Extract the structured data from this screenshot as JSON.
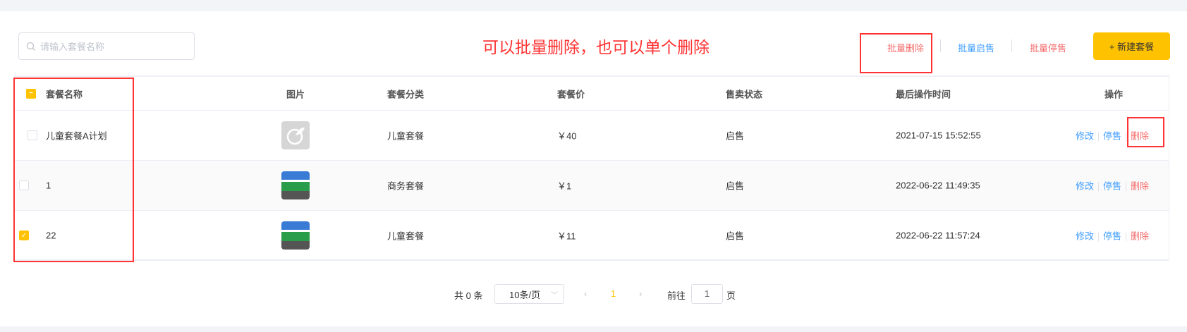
{
  "search": {
    "placeholder": "请输入套餐名称"
  },
  "annotation": "可以批量删除，也可以单个删除",
  "toolbar": {
    "batch_delete": "批量删除",
    "batch_enable": "批量启售",
    "batch_disable": "批量停售",
    "new_button": "+ 新建套餐"
  },
  "table": {
    "headers": [
      "套餐名称",
      "图片",
      "套餐分类",
      "套餐价",
      "售卖状态",
      "最后操作时间",
      "操作"
    ],
    "rows": [
      {
        "name": "儿童套餐A计划",
        "category": "儿童套餐",
        "price": "￥40",
        "status": "启售",
        "time": "2021-07-15 15:52:55",
        "checked": false
      },
      {
        "name": "1",
        "category": "商务套餐",
        "price": "￥1",
        "status": "启售",
        "time": "2022-06-22 11:49:35",
        "checked": false
      },
      {
        "name": "22",
        "category": "儿童套餐",
        "price": "￥11",
        "status": "启售",
        "time": "2022-06-22 11:57:24",
        "checked": true
      }
    ],
    "actions": {
      "edit": "修改",
      "disable": "停售",
      "delete": "删除"
    }
  },
  "pagination": {
    "total": "共 0 条",
    "page_size": "10条/页",
    "current_page": "1",
    "goto_label": "前往",
    "goto_value": "1",
    "page_suffix": "页"
  },
  "colors": {
    "accent": "#ffc200",
    "link_blue": "#419eff",
    "danger": "#f56c6c",
    "annotation_red": "#ff3333"
  }
}
